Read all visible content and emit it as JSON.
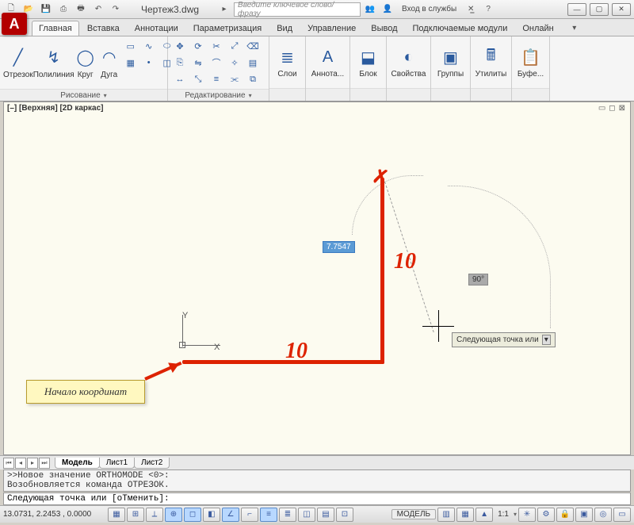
{
  "title": "Чертеж3.dwg",
  "search_placeholder": "Введите ключевое слово/фразу",
  "signin": "Вход в службы",
  "tabs": [
    "Главная",
    "Вставка",
    "Аннотации",
    "Параметризация",
    "Вид",
    "Управление",
    "Вывод",
    "Подключаемые модули",
    "Онлайн"
  ],
  "active_tab": 0,
  "panels": {
    "draw": {
      "title": "Рисование",
      "buttons": [
        "Отрезок",
        "Полилиния",
        "Круг",
        "Дуга"
      ]
    },
    "edit": {
      "title": "Редактирование"
    },
    "layers": {
      "title": "",
      "btn": "Слои"
    },
    "anno": {
      "btn": "Аннота..."
    },
    "block": {
      "btn": "Блок"
    },
    "props": {
      "btn": "Свойства"
    },
    "groups": {
      "btn": "Группы"
    },
    "utils": {
      "btn": "Утилиты"
    },
    "buf": {
      "btn": "Буфе..."
    }
  },
  "view_label": "[–] [Верхняя] [2D каркас]",
  "ucs": {
    "x": "X",
    "y": "Y"
  },
  "dim_value": "7.7547",
  "angle_value": "90°",
  "tooltip": "Следующая точка или",
  "annotation_h": "10",
  "annotation_v": "10",
  "annotation_x": "✗",
  "callout": "Начало координат",
  "sheet_tabs": [
    "Модель",
    "Лист1",
    "Лист2"
  ],
  "active_sheet": 0,
  "cmd_history": ">>Новое значение ORTHOMODE <0>:\nВозобновляется команда ОТРЕЗОК.",
  "cmd_prompt": "Следующая точка или [оТменить]:",
  "coords": "13.0731, 2.2453 , 0.0000",
  "status_right": {
    "model": "МОДЕЛЬ",
    "scale": "1:1"
  }
}
